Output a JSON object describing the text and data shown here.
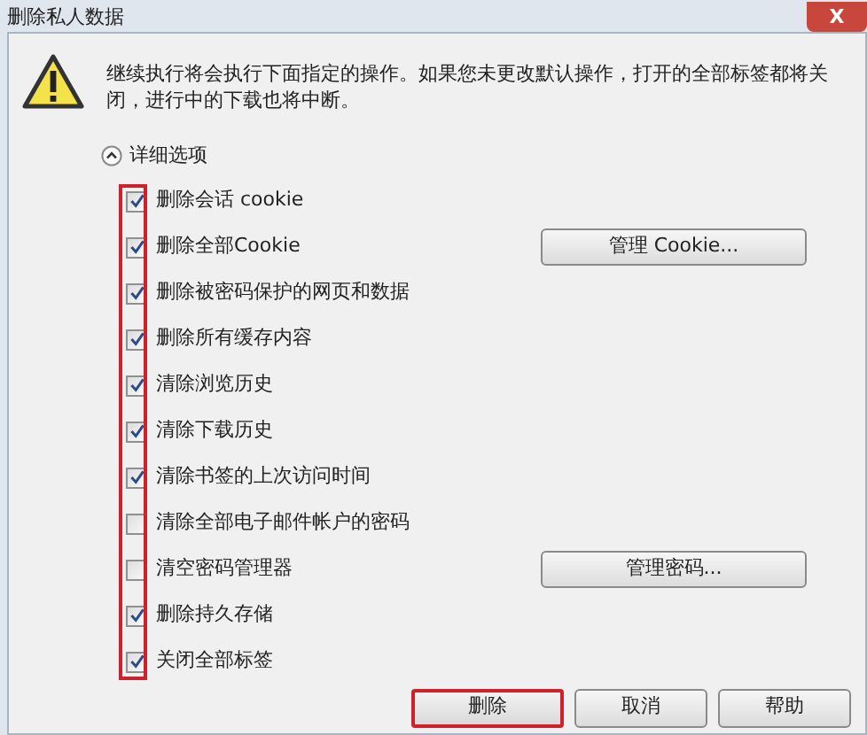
{
  "window": {
    "title": "删除私人数据",
    "close": "X"
  },
  "message": "继续执行将会执行下面指定的操作。如果您未更改默认操作，打开的全部标签都将关闭，进行中的下载也将中断。",
  "details_toggle": {
    "label": "详细选项",
    "expanded": true
  },
  "options": [
    {
      "label": "删除会话 cookie",
      "checked": true
    },
    {
      "label": "删除全部Cookie",
      "checked": true,
      "button": "管理 Cookie..."
    },
    {
      "label": "删除被密码保护的网页和数据",
      "checked": true
    },
    {
      "label": "删除所有缓存内容",
      "checked": true
    },
    {
      "label": "清除浏览历史",
      "checked": true
    },
    {
      "label": "清除下载历史",
      "checked": true
    },
    {
      "label": "清除书签的上次访问时间",
      "checked": true
    },
    {
      "label": "清除全部电子邮件帐户的密码",
      "checked": false
    },
    {
      "label": "清空密码管理器",
      "checked": false,
      "button": "管理密码..."
    },
    {
      "label": "删除持久存储",
      "checked": true
    },
    {
      "label": "关闭全部标签",
      "checked": true
    }
  ],
  "buttons": [
    {
      "label": "删除",
      "highlighted": true
    },
    {
      "label": "取消",
      "highlighted": false
    },
    {
      "label": "帮助",
      "highlighted": false
    }
  ]
}
